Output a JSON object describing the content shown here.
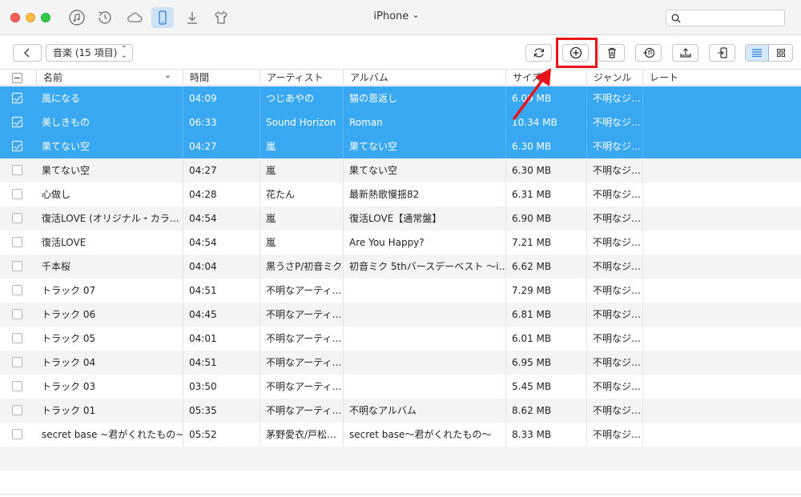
{
  "window": {
    "title": "iPhone",
    "title_chevron": "⌄"
  },
  "nav": {
    "icons": [
      {
        "name": "music-note-icon"
      },
      {
        "name": "history-restore-icon"
      },
      {
        "name": "icloud-icon"
      },
      {
        "name": "iphone-device-icon",
        "active": true
      },
      {
        "name": "download-icon"
      },
      {
        "name": "tshirt-icon"
      }
    ]
  },
  "search": {
    "placeholder": "",
    "value": ""
  },
  "toolbar": {
    "category_label": "音楽 (15 項目)",
    "buttons": [
      "refresh-icon",
      "add-icon",
      "trash-icon",
      "to-itunes-icon",
      "export-to-pc-icon",
      "send-to-device-icon"
    ],
    "accent_color": "#e8141c"
  },
  "table": {
    "columns": [
      "名前",
      "時間",
      "アーティスト",
      "アルバム",
      "サイズ",
      "ジャンル",
      "レート"
    ],
    "selected_color": "#38a8f2",
    "rows": [
      {
        "name": "風になる",
        "time": "04:09",
        "artist": "つじあやの",
        "album": "猫の恩返し",
        "size": "6.09 MB",
        "genre": "不明なジ…",
        "selected": true
      },
      {
        "name": "美しきもの",
        "time": "06:33",
        "artist": "Sound Horizon",
        "album": "Roman",
        "size": "10.34 MB",
        "genre": "不明なジ…",
        "selected": true
      },
      {
        "name": "果てない空",
        "time": "04:27",
        "artist": "嵐",
        "album": "果てない空",
        "size": "6.30 MB",
        "genre": "不明なジ…",
        "selected": true
      },
      {
        "name": "果てない空",
        "time": "04:27",
        "artist": "嵐",
        "album": "果てない空",
        "size": "6.30 MB",
        "genre": "不明なジ…",
        "selected": false
      },
      {
        "name": "心做し",
        "time": "04:28",
        "artist": "花たん",
        "album": "最新熱歌慢揺82",
        "size": "6.31 MB",
        "genre": "不明なジ…",
        "selected": false
      },
      {
        "name": "復活LOVE (オリジナル・カラ…",
        "time": "04:54",
        "artist": "嵐",
        "album": "復活LOVE【通常盤】",
        "size": "6.90 MB",
        "genre": "不明なジ…",
        "selected": false
      },
      {
        "name": "復活LOVE",
        "time": "04:54",
        "artist": "嵐",
        "album": "Are You Happy?",
        "size": "7.21 MB",
        "genre": "不明なジ…",
        "selected": false
      },
      {
        "name": "千本桜",
        "time": "04:04",
        "artist": "黒うさP/初音ミク",
        "album": "初音ミク 5thバースデーベスト 〜i…",
        "size": "6.62 MB",
        "genre": "不明なジ…",
        "selected": false
      },
      {
        "name": "トラック 07",
        "time": "04:51",
        "artist": "不明なアーティ…",
        "album": "",
        "size": "7.29 MB",
        "genre": "不明なジ…",
        "selected": false
      },
      {
        "name": "トラック 06",
        "time": "04:45",
        "artist": "不明なアーティ…",
        "album": "",
        "size": "6.81 MB",
        "genre": "不明なジ…",
        "selected": false
      },
      {
        "name": "トラック 05",
        "time": "04:01",
        "artist": "不明なアーティ…",
        "album": "",
        "size": "6.01 MB",
        "genre": "不明なジ…",
        "selected": false
      },
      {
        "name": "トラック 04",
        "time": "04:51",
        "artist": "不明なアーティ…",
        "album": "",
        "size": "6.95 MB",
        "genre": "不明なジ…",
        "selected": false
      },
      {
        "name": "トラック 03",
        "time": "03:50",
        "artist": "不明なアーティ…",
        "album": "",
        "size": "5.45 MB",
        "genre": "不明なジ…",
        "selected": false
      },
      {
        "name": "トラック 01",
        "time": "05:35",
        "artist": "不明なアーティ…",
        "album": "不明なアルバム",
        "size": "8.62 MB",
        "genre": "不明なジ…",
        "selected": false
      },
      {
        "name": "secret base ~君がくれたもの~…",
        "time": "05:52",
        "artist": "茅野愛衣/戸松…",
        "album": "secret base〜君がくれたもの〜",
        "size": "8.33 MB",
        "genre": "不明なジ…",
        "selected": false
      }
    ]
  }
}
